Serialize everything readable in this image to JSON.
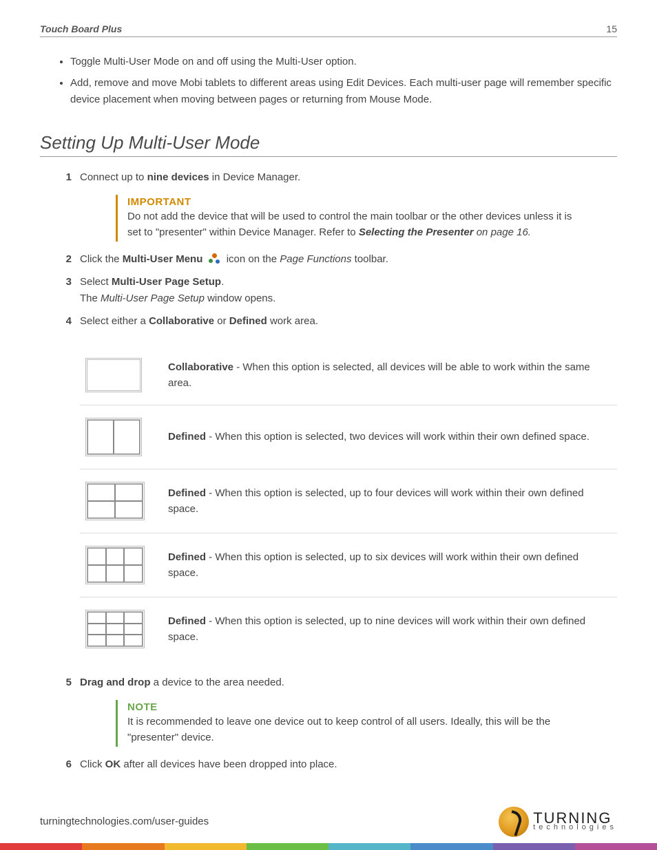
{
  "header": {
    "title": "Touch Board Plus",
    "page_number": "15"
  },
  "bullets": [
    "Toggle Multi-User Mode on and off using the Multi-User option.",
    "Add, remove and move Mobi tablets to different areas using Edit Devices. Each multi-user page will remember specific device placement when moving between pages or returning from Mouse Mode."
  ],
  "section_heading": "Setting Up Multi-User Mode",
  "steps": {
    "s1": {
      "num": "1",
      "pre": "Connect up to ",
      "bold": "nine devices",
      "post": " in Device Manager."
    },
    "important": {
      "label": "IMPORTANT",
      "text_pre": "Do not add the device that will be used to control the main toolbar or the other devices unless it is set to \"presenter\" within Device Manager. Refer to ",
      "link": "Selecting the Presenter",
      "text_post": " on page 16."
    },
    "s2": {
      "num": "2",
      "pre": "Click the ",
      "bold": "Multi-User Menu",
      "mid": " icon on the ",
      "ital": "Page Functions",
      "post": " toolbar."
    },
    "s3": {
      "num": "3",
      "pre": "Select ",
      "bold": "Multi-User Page Setup",
      "post": ".",
      "line2_pre": "The ",
      "line2_ital": "Multi-User Page Setup",
      "line2_post": " window opens."
    },
    "s4": {
      "num": "4",
      "pre": "Select either a ",
      "bold1": "Collaborative",
      "mid": " or ",
      "bold2": "Defined",
      "post": " work area."
    },
    "s5": {
      "num": "5",
      "bold": "Drag and drop",
      "post": " a device to the area needed."
    },
    "note": {
      "label": "NOTE",
      "text": "It is recommended to leave one device out to keep control of all users. Ideally, this will be the \"presenter\" device."
    },
    "s6": {
      "num": "6",
      "pre": "Click ",
      "bold": "OK",
      "post": " after all devices have been dropped into place."
    }
  },
  "options": [
    {
      "label": "Collaborative",
      "desc": " - When this option is selected, all devices will be able to work within the same area."
    },
    {
      "label": "Defined",
      "desc": " - When this option is selected, two devices will work within their own defined space."
    },
    {
      "label": "Defined",
      "desc": " - When this option is selected, up to four devices will work within their own defined space."
    },
    {
      "label": "Defined",
      "desc": " - When this option is selected, up to six devices will work within their own defined space."
    },
    {
      "label": "Defined",
      "desc": " - When this option is selected, up to nine devices will work within their own defined space."
    }
  ],
  "footer": {
    "url": "turningtechnologies.com/user-guides",
    "brand_top": "TURNING",
    "brand_bottom": "technologies"
  },
  "stripe_colors": [
    "#e13b3b",
    "#e77a1e",
    "#f0b92e",
    "#6bbf47",
    "#55b6c9",
    "#4a8cc9",
    "#7a5fae",
    "#b45097"
  ]
}
